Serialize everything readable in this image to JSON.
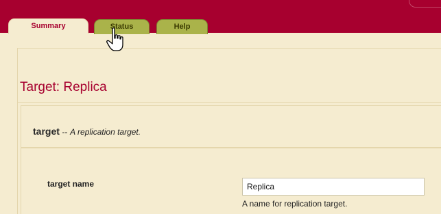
{
  "tabs": [
    {
      "label": "Summary",
      "active": true
    },
    {
      "label": "Status",
      "active": false
    },
    {
      "label": "Help",
      "active": false
    }
  ],
  "panel": {
    "title": "Target: Replica"
  },
  "description": {
    "term": "target",
    "separator": "--",
    "text": "A replication target."
  },
  "field": {
    "label": "target name",
    "value": "Replica",
    "help": "A name for replication target."
  },
  "colors": {
    "brand": "#a7002f",
    "tab_inactive": "#aab34a",
    "background": "#f5ecd0"
  },
  "icons": {
    "cursor": "hand-pointer-icon"
  }
}
